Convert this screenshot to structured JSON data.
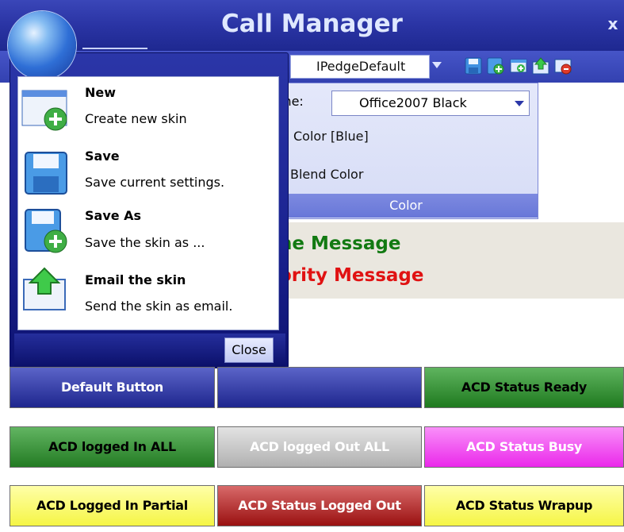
{
  "window": {
    "title": "Call Manager",
    "close_label": "x"
  },
  "toolbar": {
    "skin_value": "IPedgeDefault",
    "icons": [
      "save-icon",
      "add-icon",
      "add-window-icon",
      "upload-icon",
      "delete-icon"
    ]
  },
  "color_panel": {
    "theme_label": "me:",
    "theme_value": "Office2007 Black",
    "color_option": "Color [Blue]",
    "blend_option": "Blend Color",
    "group_label": "Color"
  },
  "messages": {
    "line1": "ne Message",
    "line1_color": "#127a12",
    "line2": "ority Message",
    "line2_color": "#e01212"
  },
  "menu": {
    "items": [
      {
        "title": "New",
        "desc": "Create new skin",
        "icon": "new-skin-icon"
      },
      {
        "title": "Save",
        "desc": "Save current settings.",
        "icon": "save-icon"
      },
      {
        "title": "Save As",
        "desc": "Save the skin as ...",
        "icon": "save-as-icon"
      },
      {
        "title": "Email the skin",
        "desc": "Send the skin as email.",
        "icon": "email-upload-icon"
      }
    ],
    "close_label": "Close"
  },
  "buttons": [
    {
      "label": "Default Button",
      "bg": "#1e268e",
      "fg": "#ffffff"
    },
    {
      "label": "",
      "bg": "#1e268e",
      "fg": "#ffffff"
    },
    {
      "label": "ACD Status Ready",
      "bg": "#1f7a1f",
      "fg": "#000000"
    },
    {
      "label": "ACD logged In ALL",
      "bg": "#237b23",
      "fg": "#000000"
    },
    {
      "label": "ACD logged Out ALL",
      "bg": "#bdbdbd",
      "fg": "#ffffff"
    },
    {
      "label": "ACD Status Busy",
      "bg": "#f238f2",
      "fg": "#ffffff"
    },
    {
      "label": "ACD Logged In Partial",
      "bg": "#fbfb5a",
      "fg": "#000000"
    },
    {
      "label": "ACD Status Logged Out",
      "bg": "#a81818",
      "fg": "#ffffff"
    },
    {
      "label": "ACD Status Wrapup",
      "bg": "#fbfb5a",
      "fg": "#000000"
    }
  ]
}
